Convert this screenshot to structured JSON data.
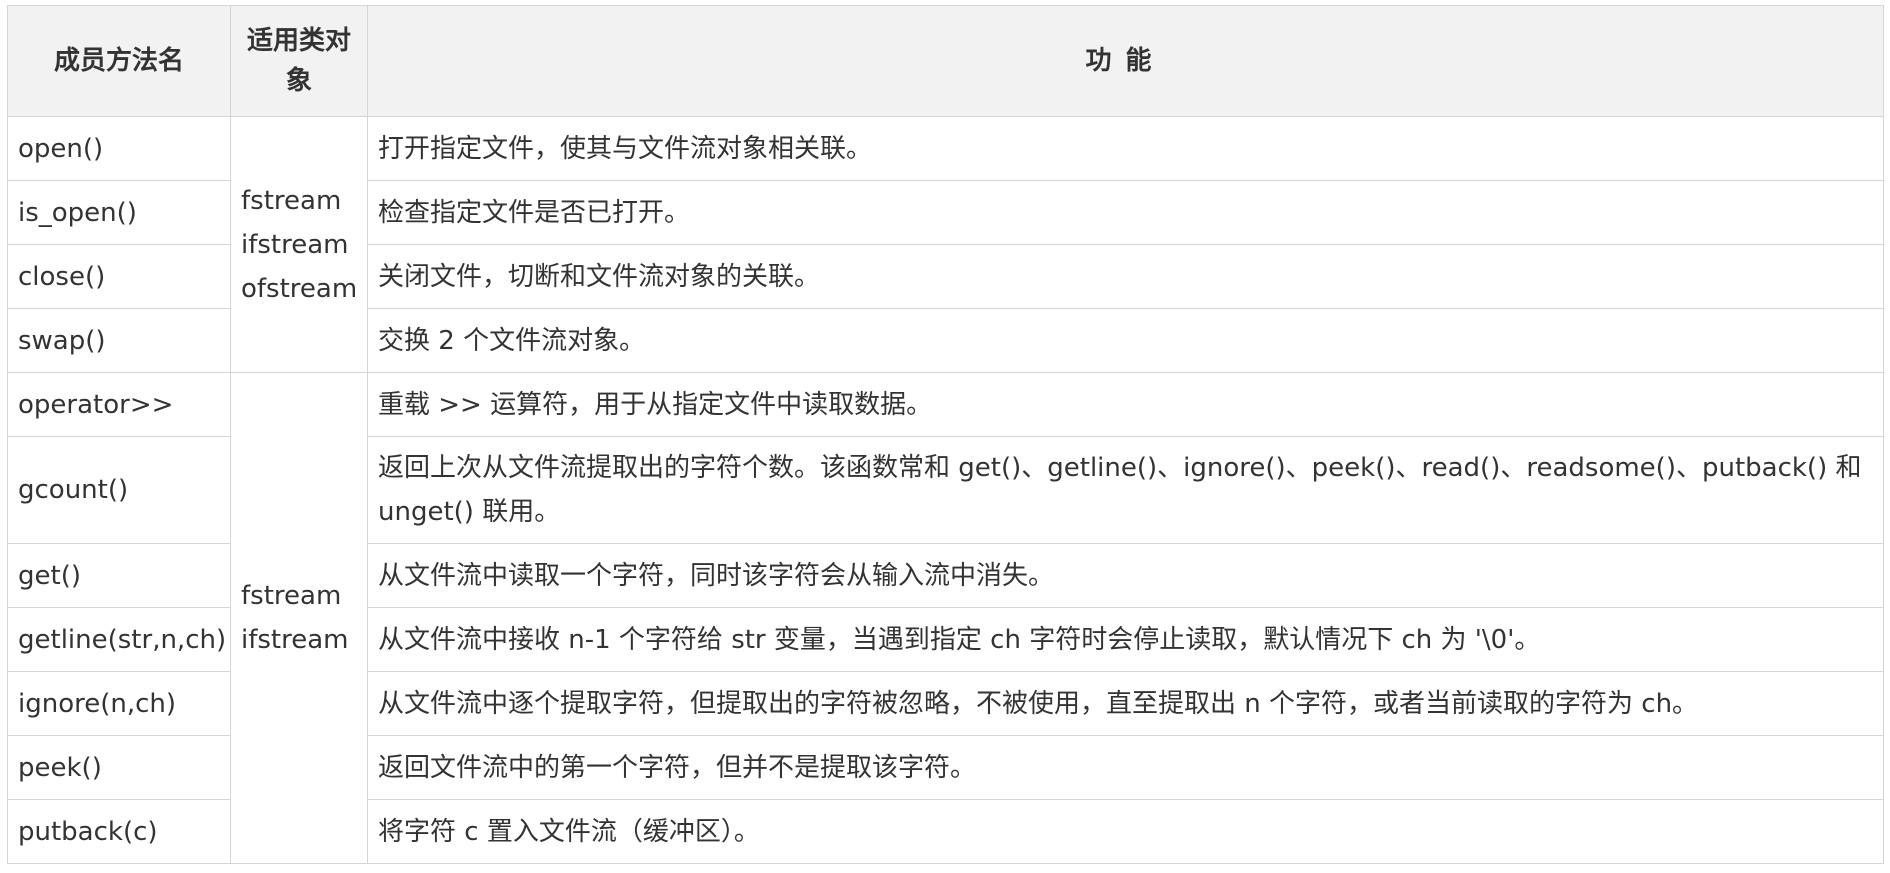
{
  "table": {
    "headers": {
      "method": "成员方法名",
      "target": "适用类对象",
      "function": "功能"
    },
    "groups": [
      {
        "targets": [
          "fstream",
          "ifstream",
          "ofstream"
        ],
        "rows": [
          {
            "method": "open()",
            "desc": "打开指定文件，使其与文件流对象相关联。"
          },
          {
            "method": "is_open()",
            "desc": "检查指定文件是否已打开。"
          },
          {
            "method": "close()",
            "desc": "关闭文件，切断和文件流对象的关联。"
          },
          {
            "method": "swap()",
            "desc": "交换 2 个文件流对象。"
          }
        ]
      },
      {
        "targets": [
          "fstream",
          "ifstream"
        ],
        "rows": [
          {
            "method": "operator>>",
            "desc": "重载 >> 运算符，用于从指定文件中读取数据。"
          },
          {
            "method": "gcount()",
            "desc": "返回上次从文件流提取出的字符个数。该函数常和 get()、getline()、ignore()、peek()、read()、readsome()、putback() 和 unget() 联用。"
          },
          {
            "method": "get()",
            "desc": "从文件流中读取一个字符，同时该字符会从输入流中消失。"
          },
          {
            "method": "getline(str,n,ch)",
            "desc": "从文件流中接收 n-1 个字符给 str 变量，当遇到指定 ch 字符时会停止读取，默认情况下 ch 为 '\\0'。"
          },
          {
            "method": "ignore(n,ch)",
            "desc": "从文件流中逐个提取字符，但提取出的字符被忽略，不被使用，直至提取出 n 个字符，或者当前读取的字符为 ch。"
          },
          {
            "method": "peek()",
            "desc": "返回文件流中的第一个字符，但并不是提取该字符。"
          },
          {
            "method": "putback(c)",
            "desc": "将字符 c 置入文件流（缓冲区）。"
          }
        ]
      }
    ]
  }
}
